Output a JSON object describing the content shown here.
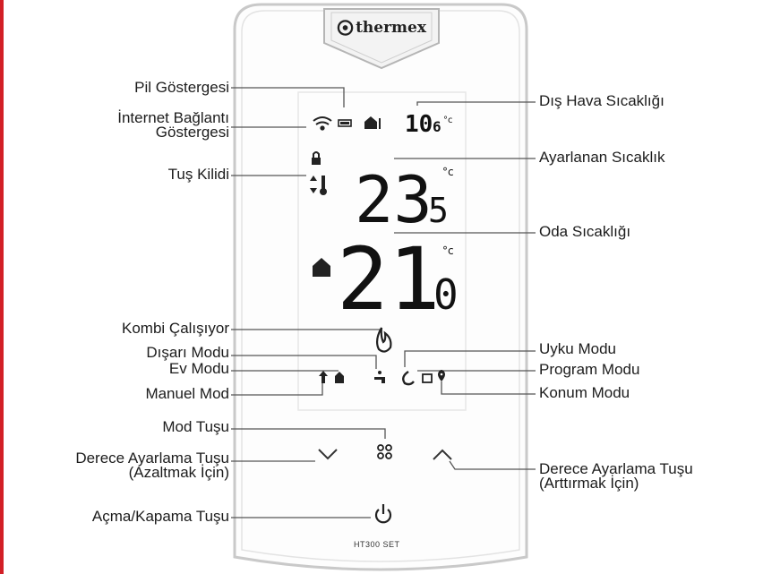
{
  "brand": {
    "name": "thermex",
    "model": "HT300 SET"
  },
  "display": {
    "outdoor_temp": {
      "int": "10",
      "dec": "6",
      "unit": "°c"
    },
    "set_temp": {
      "int": "23",
      "dec": "5",
      "unit": "°c"
    },
    "room_temp": {
      "int": "21",
      "dec": "0",
      "unit": "°c"
    }
  },
  "labels": {
    "battery": "Pil Göstergesi",
    "internet_1": "İnternet Bağlantı",
    "internet_2": "Göstergesi",
    "key_lock": "Tuş Kilidi",
    "outdoor_temp": "Dış Hava Sıcaklığı",
    "set_temp": "Ayarlanan Sıcaklık",
    "room_temp": "Oda Sıcaklığı",
    "boiler_running": "Kombi Çalışıyor",
    "away_mode": "Dışarı Modu",
    "home_mode": "Ev Modu",
    "manual_mode": "Manuel Mod",
    "sleep_mode": "Uyku Modu",
    "program_mode": "Program Modu",
    "location_mode": "Konum Modu",
    "mode_key": "Mod Tuşu",
    "down_key_1": "Derece Ayarlama Tuşu",
    "down_key_2": "(Azaltmak İçin)",
    "up_key_1": "Derece Ayarlama Tuşu",
    "up_key_2": "(Arttırmak İçin)",
    "power_key": "Açma/Kapama Tuşu"
  },
  "colors": {
    "accent": "#d21f26",
    "line": "#555555"
  }
}
